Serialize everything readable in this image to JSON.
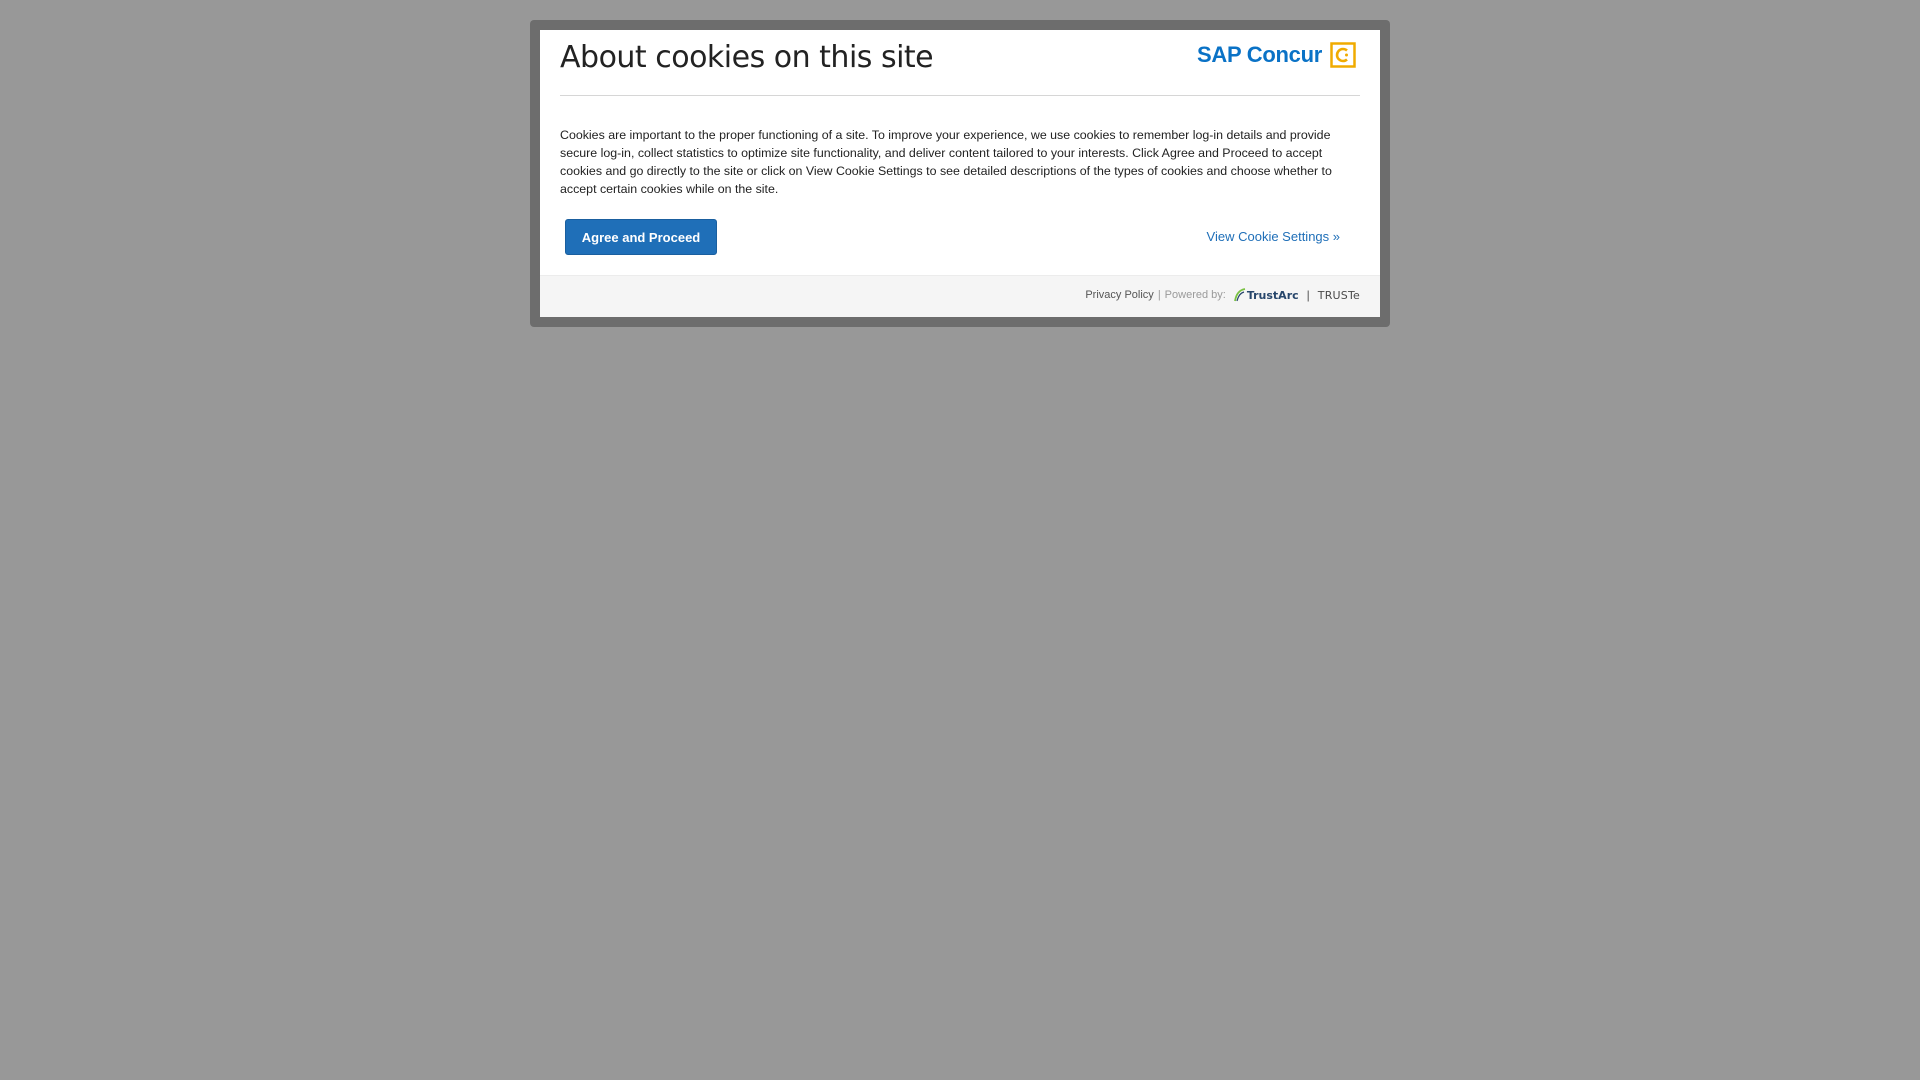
{
  "dialog": {
    "title": "About cookies on this site",
    "brand": {
      "name": "SAP Concur",
      "color": "#0a72c6",
      "mark_color": "#f0ab00",
      "mark_icon": "concur-c-icon"
    },
    "body": "Cookies are important to the proper functioning of a site. To improve your experience, we use cookies to remember log-in details and provide secure log-in, collect statistics to optimize site functionality, and deliver content tailored to your interests. Click Agree and Proceed to accept cookies and go directly to the site or click on View Cookie Settings to see detailed descriptions of the types of cookies and choose whether to accept certain cookies while on the site.",
    "agree_label": "Agree and Proceed",
    "settings_label": "View Cookie Settings »",
    "accent_color": "#1f6fb8"
  },
  "footer": {
    "privacy_label": "Privacy Policy",
    "separator": "|",
    "powered_label": "Powered by:",
    "trustarc_label": "TrustArc",
    "logo_separator": "|",
    "truste_label": "TRUSTe"
  }
}
